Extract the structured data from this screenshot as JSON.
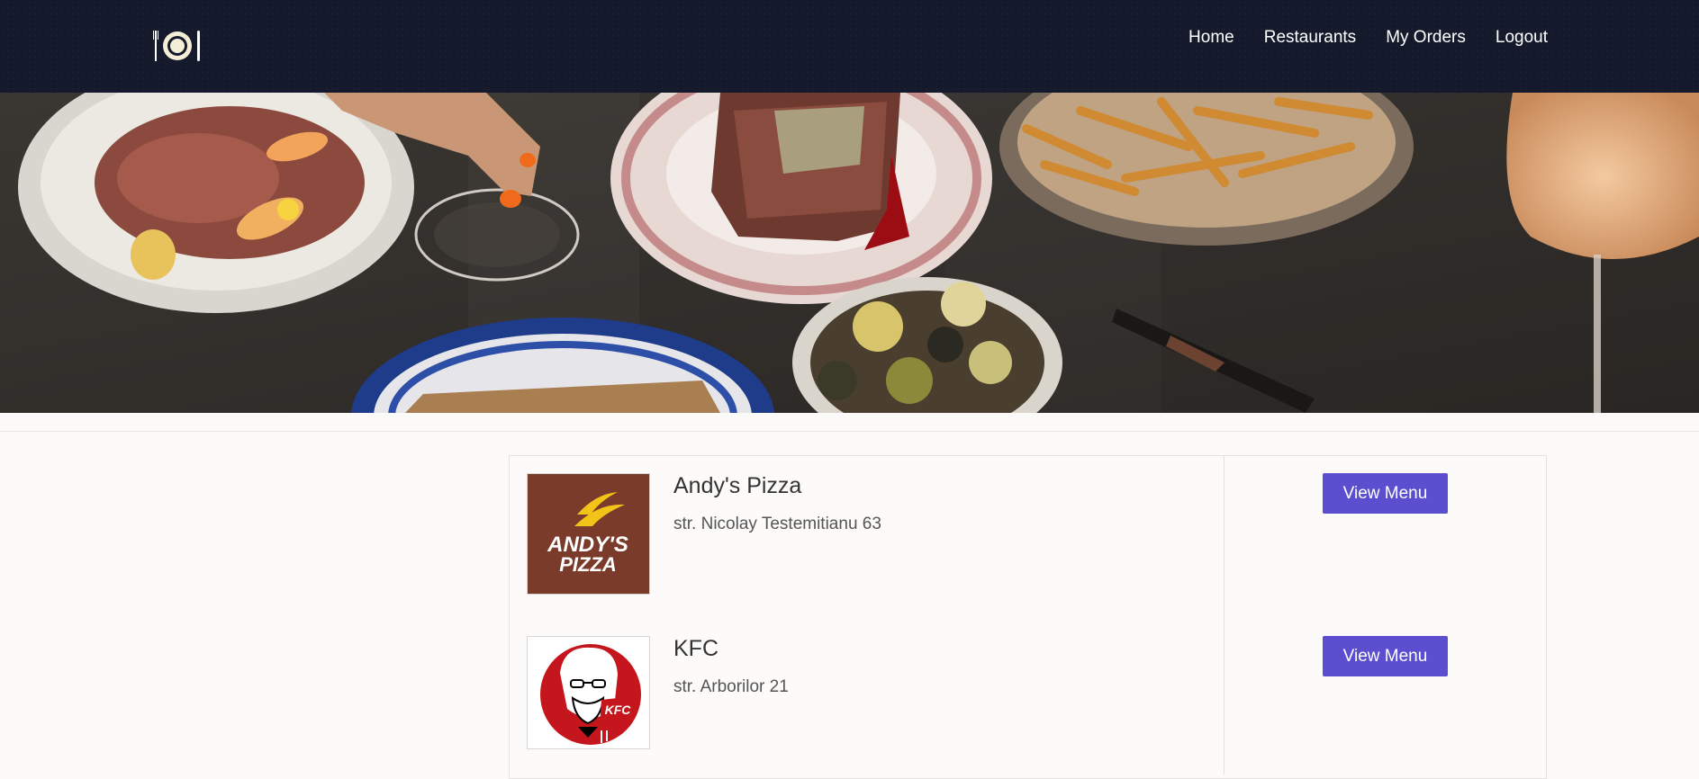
{
  "nav": {
    "logo_icon": "plate-and-cutlery-icon",
    "links": [
      "Home",
      "Restaurants",
      "My Orders",
      "Logout"
    ]
  },
  "hero": {
    "image": "food-table-banner"
  },
  "restaurants": [
    {
      "name": "Andy's Pizza",
      "address": "str. Nicolay Testemitianu 63",
      "button": "View Menu",
      "logo": "andys-pizza-logo",
      "logo_text_1": "ANDY'S",
      "logo_text_2": "PIZZA"
    },
    {
      "name": "KFC",
      "address": "str. Arborilor 21",
      "button": "View Menu",
      "logo": "kfc-logo",
      "logo_text": "KFC"
    }
  ],
  "colors": {
    "navbar": "#141a2b",
    "button": "#5b4fd0",
    "pizza_logo_bg": "#7a3b2a",
    "kfc_red": "#c4161c"
  }
}
